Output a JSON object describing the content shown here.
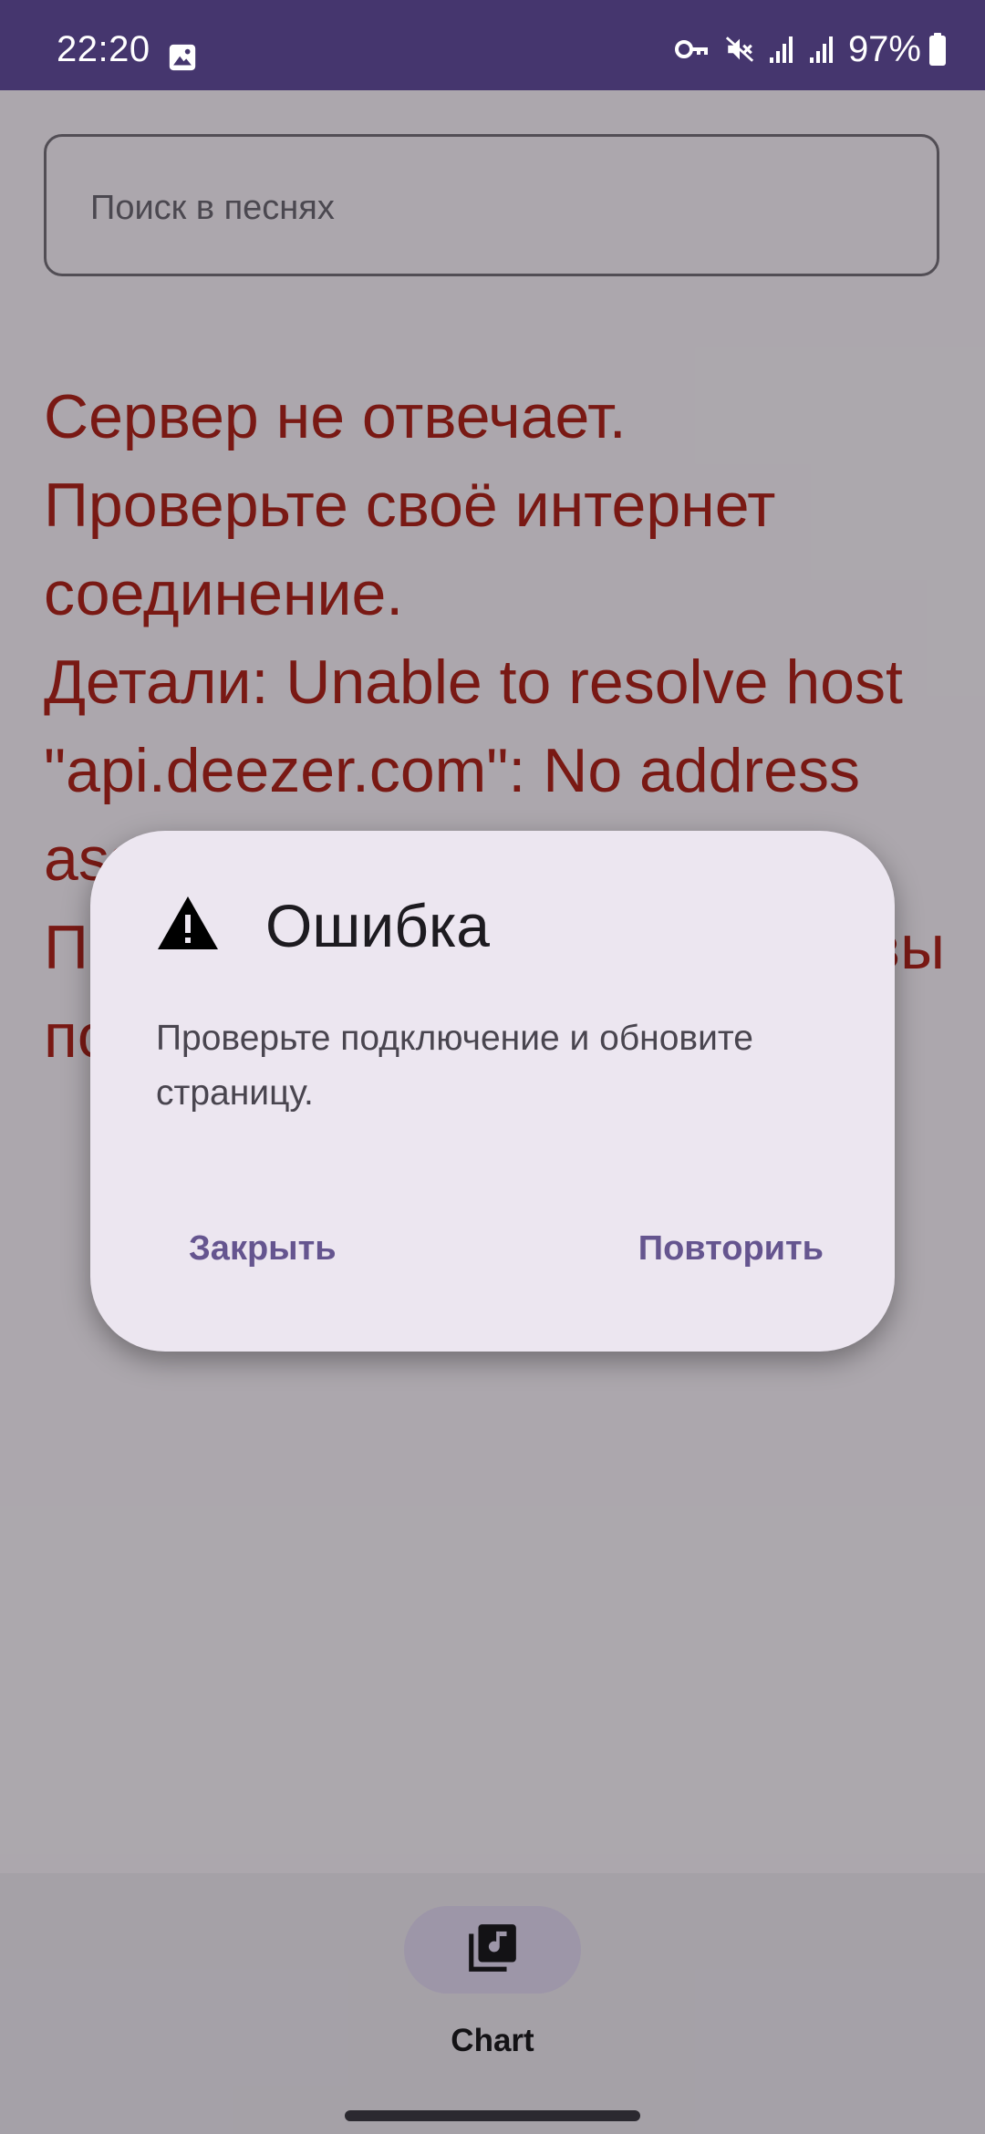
{
  "status_bar": {
    "time": "22:20",
    "battery_percent": "97%",
    "left_icons": [
      "image-icon"
    ],
    "right_icons": [
      "vpn-key-icon",
      "mute-icon",
      "signal-icon",
      "signal-icon",
      "battery-icon"
    ]
  },
  "search": {
    "placeholder": "Поиск в песнях"
  },
  "error_message": "Сервер не отвечает.\nПроверьте своё интернет соединение.\nДетали: Unable to resolve host \"api.deezer.com\": No address associated with hostname\nПожалуйста, проверьте, что вы подключены к сети",
  "dialog": {
    "icon": "warning-icon",
    "title": "Ошибка",
    "message": "Проверьте подключение и обновите страницу.",
    "close_label": "Закрыть",
    "retry_label": "Повторить"
  },
  "bottom_nav": {
    "items": [
      {
        "label": "Chart",
        "icon": "library-music-icon",
        "selected": true
      }
    ]
  },
  "colors": {
    "status_bar": "#45366E",
    "error_text": "#B3261E",
    "dialog_background": "#ECE6F0",
    "dialog_action": "#65558F",
    "nav_indicator": "#E8DEF8"
  }
}
